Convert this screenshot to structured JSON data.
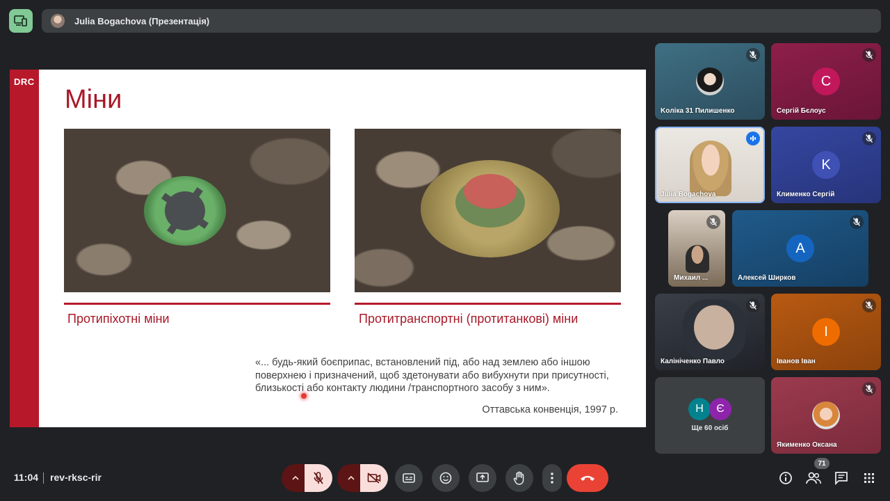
{
  "header": {
    "presenter_banner": "Julia Bogachova (Презентація)",
    "present_icon": "devices-icon"
  },
  "slide": {
    "logo": "DRC",
    "title": "Міни",
    "caption_left": "Протипіхотні міни",
    "caption_right": "Протитранспортні (протитанкові) міни",
    "quote_line1": "«... будь-який боєприпас, встановлений під, або над землею або іншою",
    "quote_line2": "поверхнею і призначений, щоб здетонувати або вибухнути при присутності,",
    "quote_line3": "близькості або контакту людини /транспортного засобу з ним».",
    "quote_source": "Оттавська конвенція, 1997 р.",
    "accent_color": "#b7192b"
  },
  "participants": [
    {
      "name": "Koліка 31 Пилишенко",
      "muted": true,
      "avatar": "photo"
    },
    {
      "name": "Сергій Бєлоус",
      "muted": true,
      "avatar": "C",
      "color": "#c2185b"
    },
    {
      "name": "Julia Bogachova",
      "muted": false,
      "speaking": true,
      "avatar": "video"
    },
    {
      "name": "Клименко Сергій",
      "muted": true,
      "avatar": "K",
      "color": "#3f51b5"
    },
    {
      "name": "Михаил ...",
      "muted": true,
      "avatar": "video"
    },
    {
      "name": "Алексей Ширков",
      "muted": true,
      "avatar": "A",
      "color": "#1565c0"
    },
    {
      "name": "Калініченко Павло",
      "muted": true,
      "avatar": "video"
    },
    {
      "name": "Іванов Іван",
      "muted": true,
      "avatar": "I",
      "color": "#ef6c00"
    },
    {
      "name": "Якименко Оксана",
      "muted": true,
      "avatar": "photo"
    }
  ],
  "others": {
    "label": "Ще 60 осіб",
    "avatar1": "Н",
    "avatar2": "Є"
  },
  "footer": {
    "time": "11:04",
    "meeting_code": "rev-rksc-rir",
    "participant_count": "71"
  },
  "controls": {
    "mic": "mic-off-icon",
    "camera": "videocam-off-icon",
    "captions": "closed-caption-icon",
    "emoji": "emoji-icon",
    "present": "present-screen-icon",
    "hand": "raise-hand-icon",
    "more": "more-vert-icon",
    "leave": "call-end-icon"
  }
}
